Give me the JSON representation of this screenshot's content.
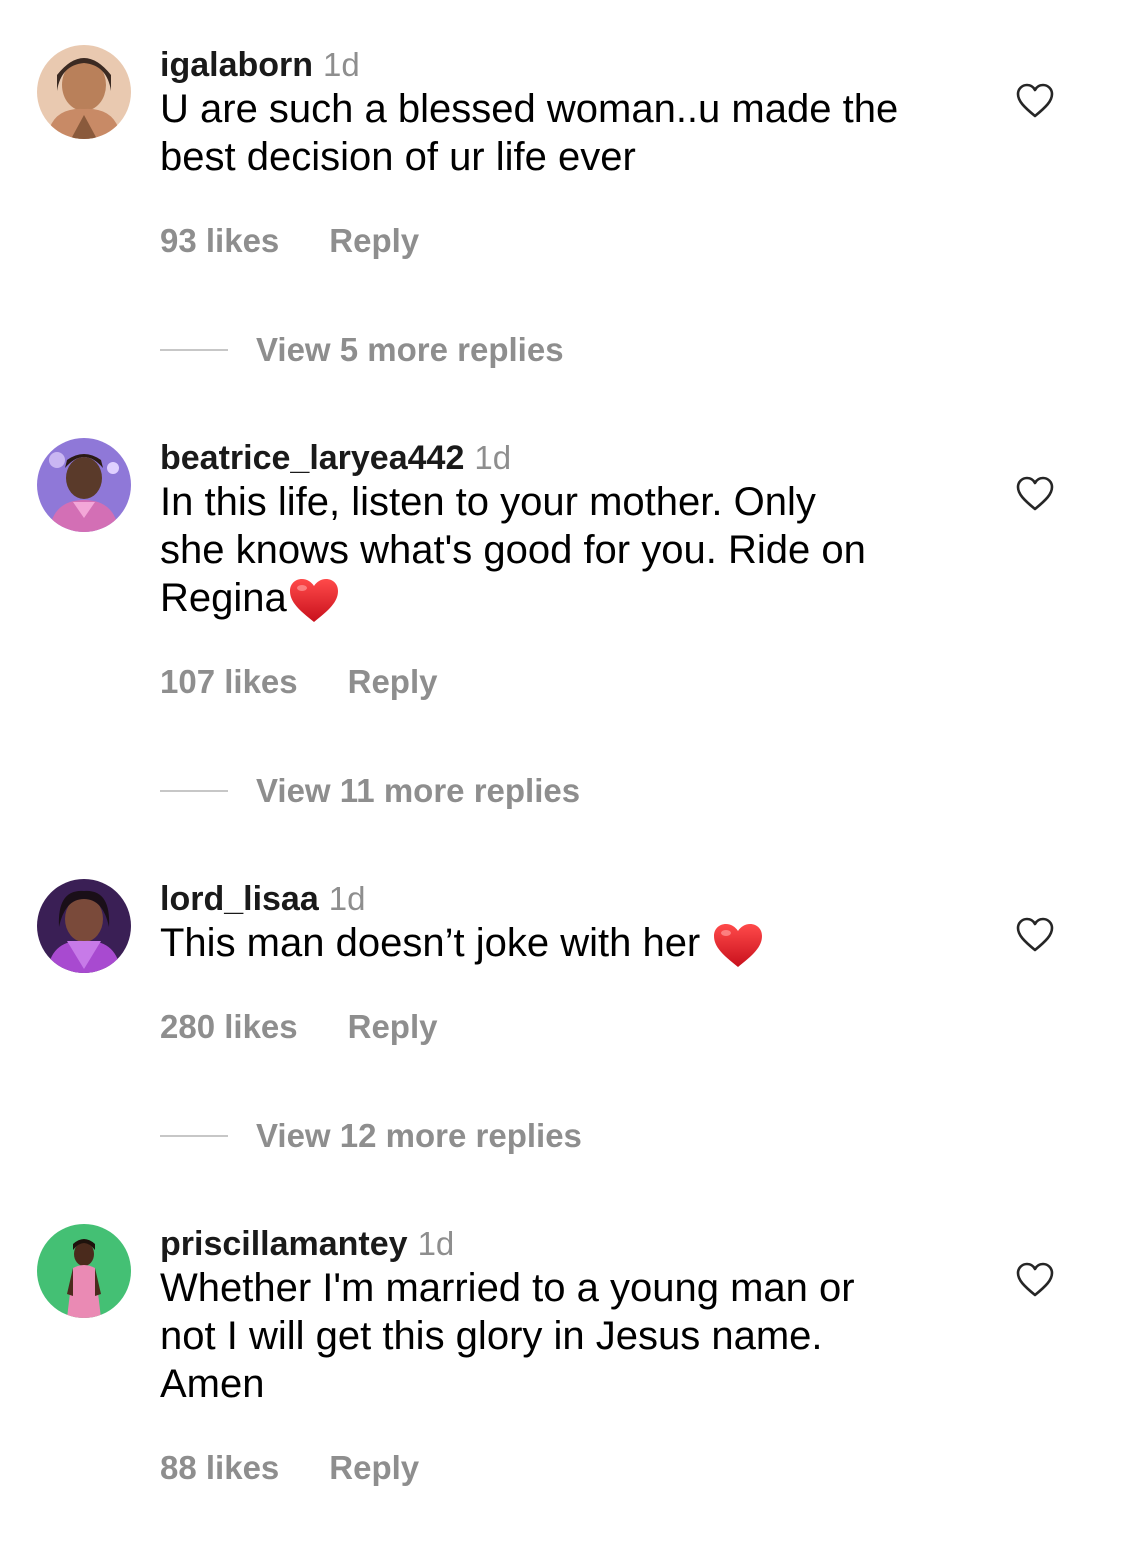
{
  "comments": [
    {
      "username": "igalaborn",
      "time": "1d",
      "text_lines": [
        "U are such a blessed woman..u made the",
        "best decision of ur life ever"
      ],
      "likes": "93 likes",
      "reply": "Reply",
      "view_replies": "View 5 more replies",
      "avatar_colors": [
        "#d9a37c",
        "#8a5a3c",
        "#3b2a22"
      ]
    },
    {
      "username": "beatrice_laryea442",
      "time": "1d",
      "text_lines": [
        "In this life, listen to your mother. Only",
        "she knows what's good for you. Ride on",
        "Regina"
      ],
      "likes": "107 likes",
      "reply": "Reply",
      "view_replies": "View 11 more replies",
      "avatar_colors": [
        "#7a5fc9",
        "#d36fb5",
        "#3a2a2a"
      ]
    },
    {
      "username": "lord_lisaa",
      "time": "1d",
      "text_lines": [
        "This man doesn’t joke with her "
      ],
      "likes": "280 likes",
      "reply": "Reply",
      "view_replies": "View 12 more replies",
      "avatar_colors": [
        "#5b2a8c",
        "#b04ad0",
        "#2a1530"
      ]
    },
    {
      "username": "priscillamantey",
      "time": "1d",
      "text_lines": [
        "Whether I'm married to a young man or",
        "not I will get this glory in Jesus name.",
        "Amen"
      ],
      "likes": "88 likes",
      "reply": "Reply",
      "avatar_colors": [
        "#3fbf6e",
        "#e889b0",
        "#2b1a14"
      ]
    }
  ],
  "icons": {
    "like": "heart-outline-icon",
    "emoji": "red-heart-emoji"
  },
  "colors": {
    "meta_gray": "#8e8e8e",
    "heart_red": "#e0202c"
  }
}
